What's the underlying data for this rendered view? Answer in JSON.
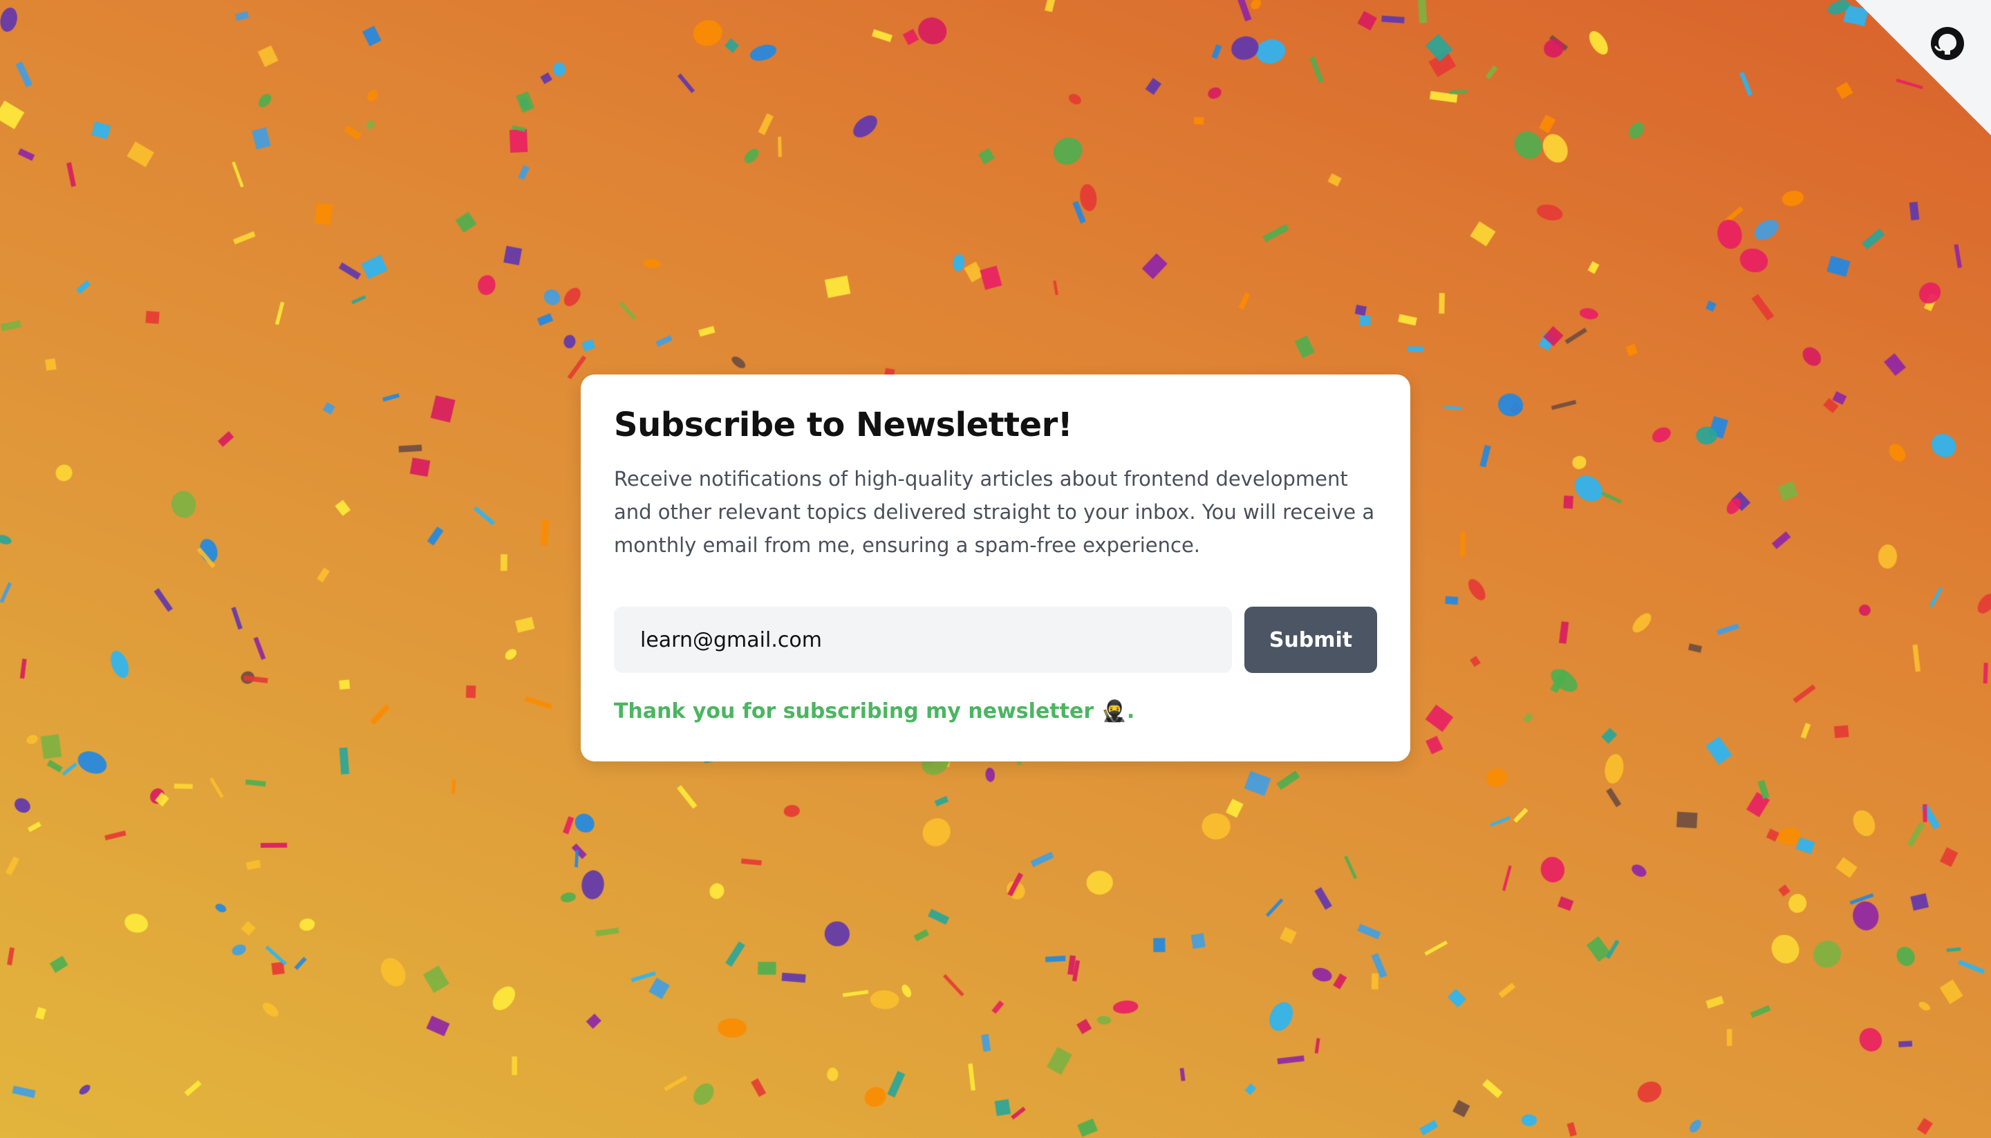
{
  "newsletter": {
    "title": "Subscribe to Newsletter!",
    "description": "Receive notifications of high-quality articles about frontend development and other relevant topics delivered straight to your inbox. You will receive a monthly email from me, ensuring a spam-free experience.",
    "email_value": "learn@gmail.com",
    "submit_label": "Submit",
    "success_message": "Thank you for subscribing my newsletter 🥷."
  },
  "corner": {
    "icon": "github-icon"
  },
  "colors": {
    "card_background": "#ffffff",
    "button_background": "#4b5563",
    "success_text": "#4cb562",
    "input_background": "#f3f4f6",
    "confetti_palette": [
      "#e53935",
      "#3f9fe6",
      "#5e35b1",
      "#8e24aa",
      "#7cb342",
      "#fbc02d",
      "#fdd835",
      "#26a69a",
      "#fb8c00",
      "#d81b60",
      "#4caf50",
      "#6d4c41",
      "#29b6f6",
      "#e91e63",
      "#1e88e5",
      "#ffeb3b"
    ]
  },
  "effect": {
    "confetti_pieces": 420
  }
}
